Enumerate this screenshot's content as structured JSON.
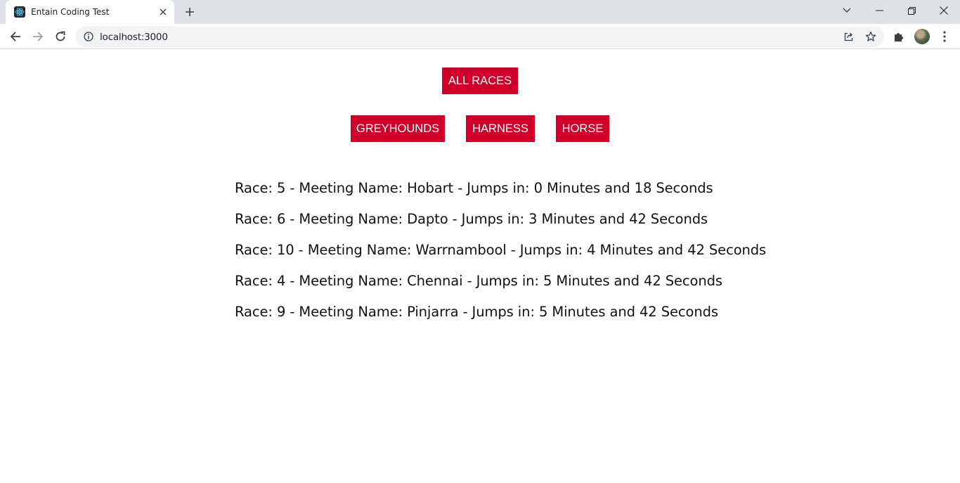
{
  "browser": {
    "tab_title": "Entain Coding Test",
    "url": "localhost:3000"
  },
  "filters": {
    "all_label": "ALL RACES",
    "categories": [
      "GREYHOUNDS",
      "HARNESS",
      "HORSE"
    ]
  },
  "races": [
    "Race: 5 - Meeting Name: Hobart - Jumps in: 0 Minutes and 18 Seconds",
    "Race: 6 - Meeting Name: Dapto - Jumps in: 3 Minutes and 42 Seconds",
    "Race: 10 - Meeting Name: Warrnambool - Jumps in: 4 Minutes and 42 Seconds",
    "Race: 4 - Meeting Name: Chennai - Jumps in: 5 Minutes and 42 Seconds",
    "Race: 9 - Meeting Name: Pinjarra - Jumps in: 5 Minutes and 42 Seconds"
  ],
  "colors": {
    "button_bg": "#d1002b",
    "button_text": "#ffffff",
    "chrome_bg": "#dee1e6"
  },
  "icons": {
    "favicon": "react-icon",
    "info": "info-icon",
    "share": "share-icon",
    "star": "star-icon",
    "extensions": "puzzle-icon",
    "menu": "kebab-menu-icon"
  }
}
